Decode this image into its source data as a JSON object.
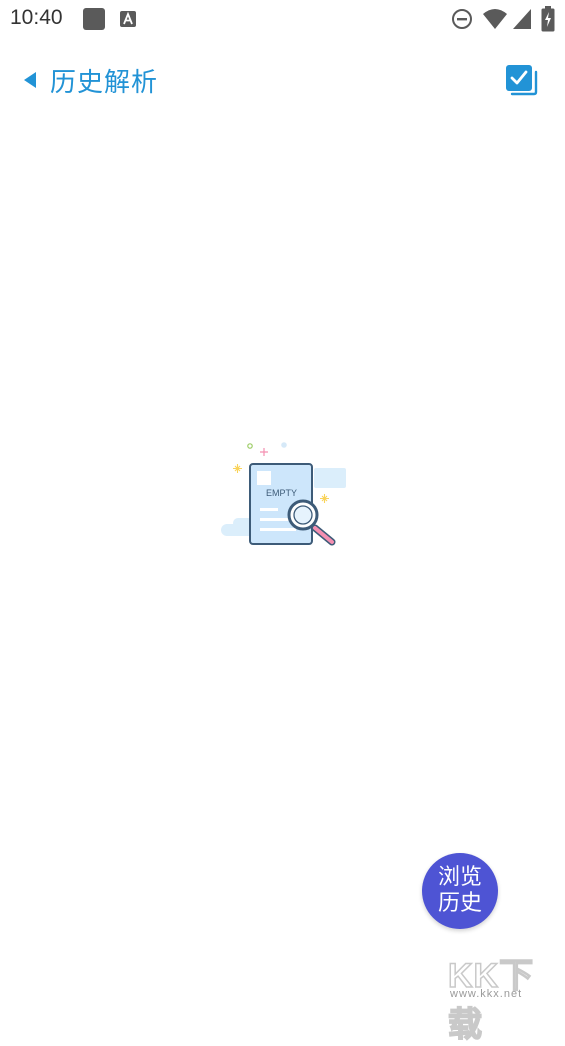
{
  "status_bar": {
    "time": "10:40",
    "left_icons": [
      "app-square-icon",
      "text-a-icon"
    ],
    "right_icons": [
      "do-not-disturb-icon",
      "wifi-icon",
      "signal-icon",
      "battery-charging-icon"
    ]
  },
  "header": {
    "title": "历史解析",
    "back_icon": "back-arrow-icon",
    "action_icon": "multi-select-checkbox-icon",
    "accent_color": "#2293d6"
  },
  "empty_state": {
    "illustration_text": "EMPTY"
  },
  "fab": {
    "line1": "浏览",
    "line2": "历史",
    "color": "#4e54d4"
  },
  "watermark": {
    "main": "KK下载",
    "url": "www.kkx.net"
  }
}
